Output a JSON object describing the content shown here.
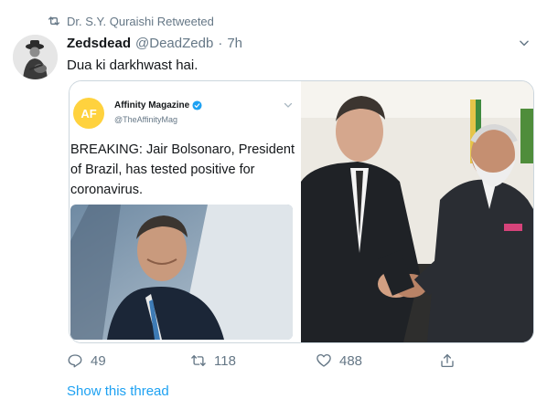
{
  "retweet": {
    "label": "Dr. S.Y. Quraishi Retweeted"
  },
  "tweet": {
    "name": "Zedsdead",
    "handle": "@DeadZedb",
    "separator": "·",
    "time": "7h",
    "text": "Dua ki darkhwast hai."
  },
  "quoted": {
    "avatar_text": "AF",
    "name": "Affinity Magazine",
    "handle": "@TheAffinityMag",
    "text": "BREAKING: Jair Bolsonaro, President of Brazil, has tested positive for coronavirus."
  },
  "actions": {
    "reply_count": "49",
    "retweet_count": "118",
    "like_count": "488"
  },
  "footer": {
    "show_thread": "Show this thread"
  },
  "colors": {
    "accent": "#1da1f2",
    "muted": "#657786",
    "text": "#14171a",
    "avatar_yellow": "#ffd23e"
  },
  "icons": {
    "retweet_header": "retweet-icon",
    "chevron": "chevron-down-icon",
    "verified": "verified-badge-icon",
    "reply": "reply-icon",
    "retweet": "retweet-icon",
    "like": "heart-icon",
    "share": "share-icon"
  }
}
